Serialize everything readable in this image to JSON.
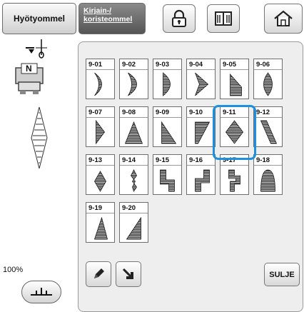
{
  "tabs": {
    "utility_label": "Hyötyommel",
    "letters_line1": "Kirjain-/",
    "letters_line2": "koristeommel"
  },
  "toolbar": {
    "icons": [
      "padlock-icon",
      "book-icon",
      "home-icon"
    ]
  },
  "sidebar": {
    "presser_foot_letter": "N",
    "zoom_label": "100%"
  },
  "grid": {
    "selected": "9-11",
    "stitches": [
      {
        "code": "9-01",
        "shape": "crescent-thin"
      },
      {
        "code": "9-02",
        "shape": "crescent-thick"
      },
      {
        "code": "9-03",
        "shape": "half-oval"
      },
      {
        "code": "9-04",
        "shape": "chevron"
      },
      {
        "code": "9-05",
        "shape": "slant-wedge"
      },
      {
        "code": "9-06",
        "shape": "oval"
      },
      {
        "code": "9-07",
        "shape": "arrow-right"
      },
      {
        "code": "9-08",
        "shape": "triangle"
      },
      {
        "code": "9-09",
        "shape": "right-triangle"
      },
      {
        "code": "9-10",
        "shape": "inverted-wedge"
      },
      {
        "code": "9-11",
        "shape": "diamond"
      },
      {
        "code": "9-12",
        "shape": "slanted-band"
      },
      {
        "code": "9-13",
        "shape": "small-diamond"
      },
      {
        "code": "9-14",
        "shape": "zigzag-thin"
      },
      {
        "code": "9-15",
        "shape": "step-down"
      },
      {
        "code": "9-16",
        "shape": "step-up"
      },
      {
        "code": "9-17",
        "shape": "zigzag-block"
      },
      {
        "code": "9-18",
        "shape": "dome"
      },
      {
        "code": "9-19",
        "shape": "tall-triangle"
      },
      {
        "code": "9-20",
        "shape": "ramp"
      }
    ]
  },
  "buttons": {
    "close_label": "SULJE"
  }
}
